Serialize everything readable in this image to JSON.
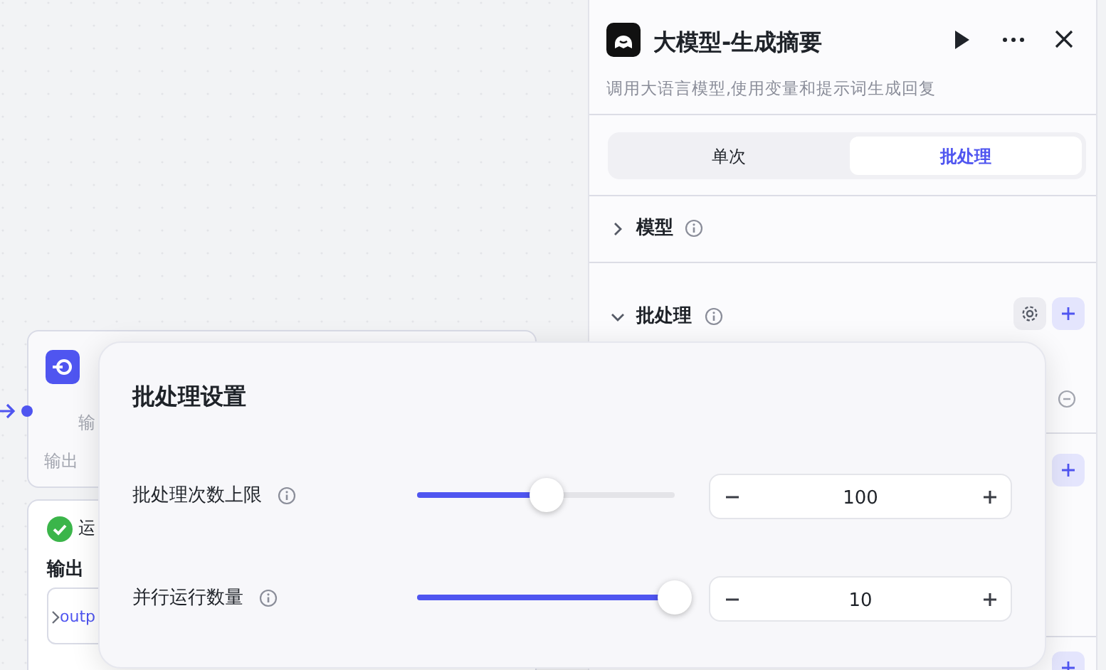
{
  "input_node": {
    "row_1": "输",
    "row_2": "输出"
  },
  "status_node": {
    "status": "运",
    "output_label": "输出",
    "field_value": "outp"
  },
  "panel": {
    "title": "大模型-生成摘要",
    "description": "调用大语言模型,使用变量和提示词生成回复",
    "tabs": [
      {
        "label": "单次",
        "selected": false
      },
      {
        "label": "批处理",
        "selected": true
      }
    ],
    "sections": [
      {
        "label": "模型",
        "expanded": false
      },
      {
        "label": "批处理",
        "expanded": true
      }
    ]
  },
  "dialog": {
    "title": "批处理设置",
    "settings": [
      {
        "label": "批处理次数上限",
        "level": 0.5,
        "value": "100"
      },
      {
        "label": "并行运行数量",
        "level": 1,
        "value": "10"
      }
    ]
  }
}
